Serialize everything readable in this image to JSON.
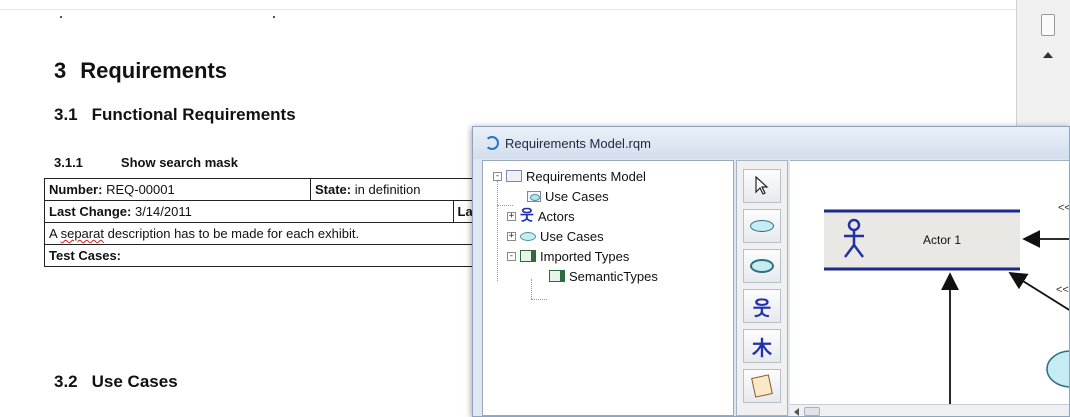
{
  "document": {
    "heading_requirements": {
      "num": "3",
      "text": "Requirements"
    },
    "heading_functional": {
      "num": "3.1",
      "text": "Functional Requirements"
    },
    "heading_search": {
      "num": "3.1.1",
      "text": "Show search mask"
    },
    "table": {
      "number_label": "Number:",
      "number_value": "REQ-00001",
      "state_label": "State:",
      "state_value": "in definition",
      "last_change_label": "Last Change:",
      "last_change_value": "3/14/2011",
      "last_change_cut": "La",
      "description_word_misspelled": "separat",
      "description_prefix": "A",
      "description_rest": "description has to be made for each exhibit.",
      "test_cases_label": "Test Cases:"
    },
    "heading_use_cases": {
      "num": "3.2",
      "text": "Use Cases"
    }
  },
  "window": {
    "title": "Requirements Model.rqm",
    "tree": {
      "root": "Requirements Model",
      "items": [
        "Use Cases",
        "Actors",
        "Use Cases",
        "Imported Types"
      ],
      "subitem": "SemanticTypes",
      "expanders": {
        "root": "-",
        "actors": "+",
        "use_cases": "+",
        "imported": "-"
      }
    },
    "palette_tools": [
      "select-cursor",
      "use-case",
      "extension-use-case",
      "actor",
      "actor-group",
      "note"
    ],
    "diagram": {
      "actor_label": "Actor 1",
      "stereo_1": "<<",
      "stereo_2": "<<"
    }
  },
  "colors": {
    "actor_blue": "#2231a8",
    "usecase_fill": "#c6ecf3",
    "window_frame": "#8fa3bf",
    "title_bar": "#d3deed"
  }
}
